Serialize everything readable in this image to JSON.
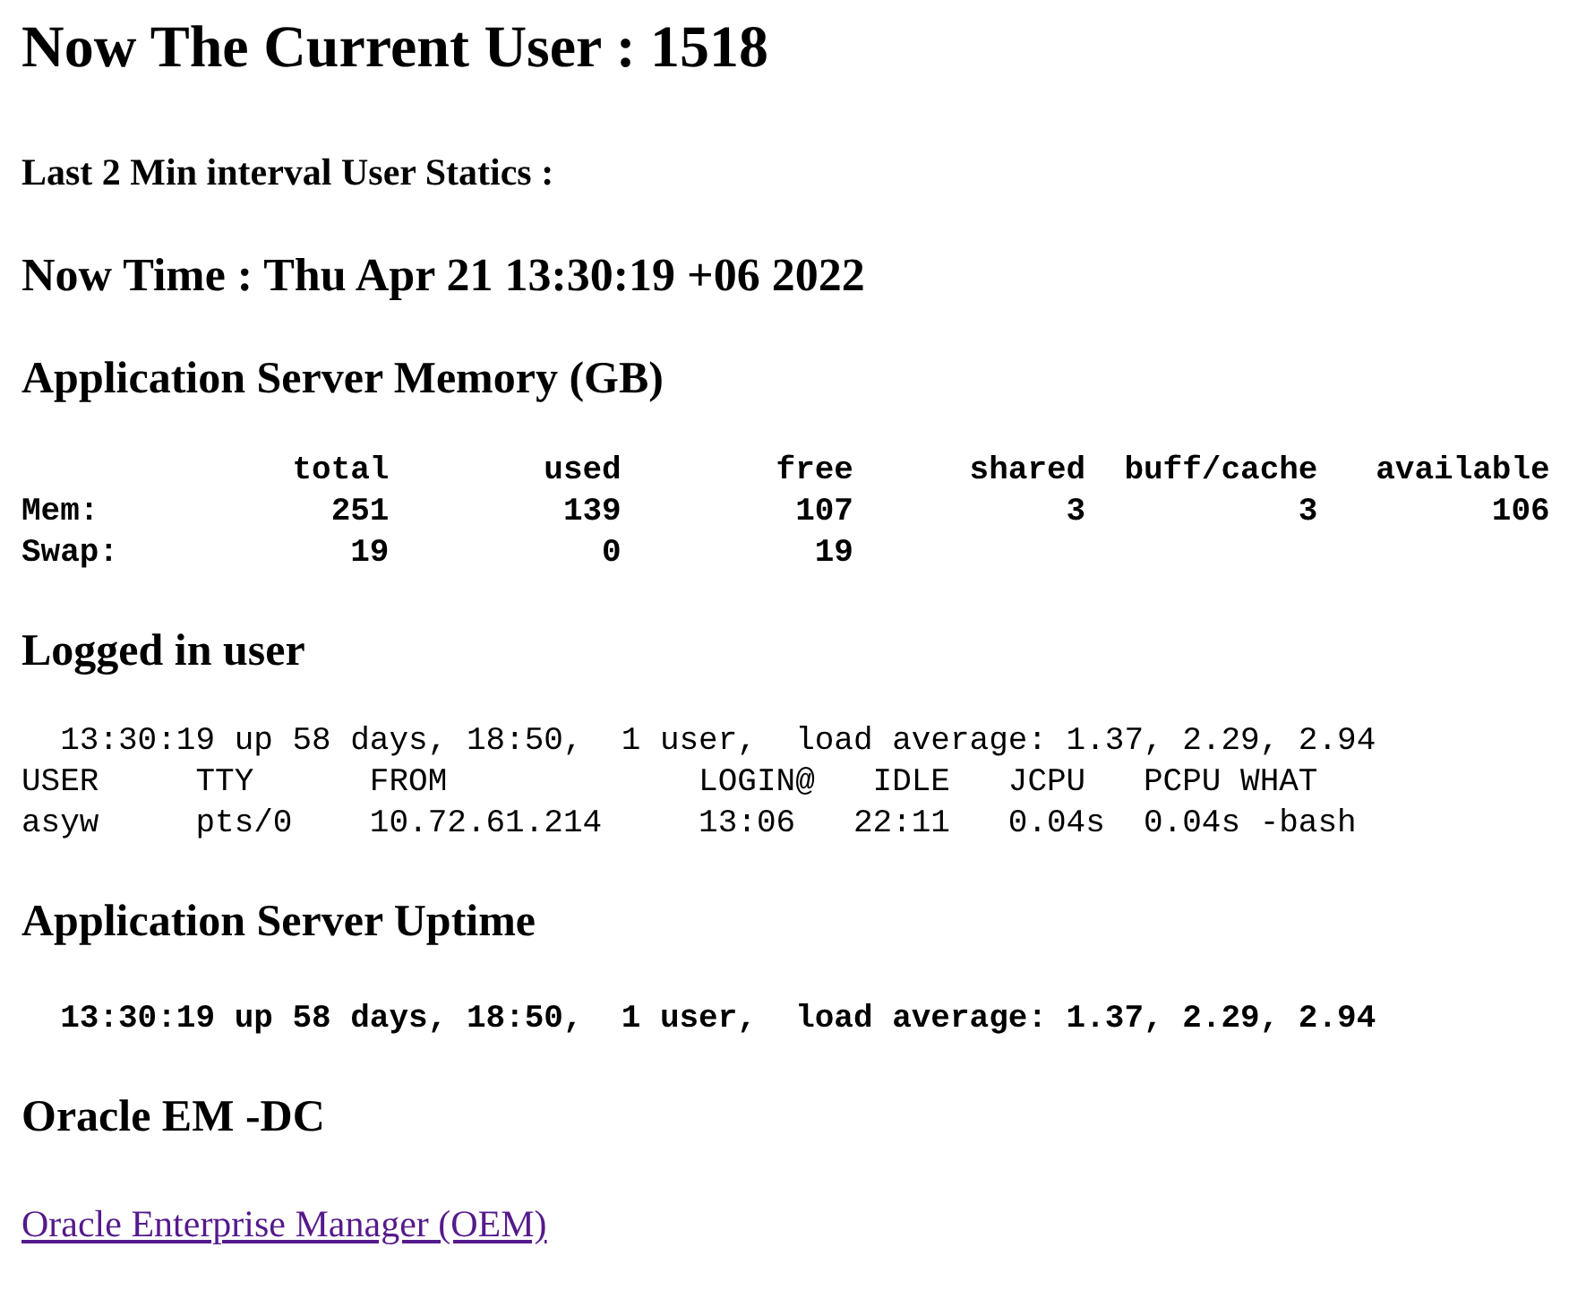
{
  "title": "Now The Current User : 1518",
  "subtitle": "Last 2 Min interval User Statics :",
  "now_time": "Now Time : Thu Apr 21 13:30:19 +06 2022",
  "sections": [
    {
      "heading": "Application Server Memory (GB)",
      "kind": "console",
      "bold": true,
      "lines": [
        "              total        used        free      shared  buff/cache   available",
        "Mem:            251         139         107           3           3         106",
        "Swap:            19           0          19"
      ]
    },
    {
      "heading": "Logged in user",
      "kind": "console",
      "bold": false,
      "lines": [
        "  13:30:19 up 58 days, 18:50,  1 user,  load average: 1.37, 2.29, 2.94",
        "USER     TTY      FROM             LOGIN@   IDLE   JCPU   PCPU WHAT",
        "asyw     pts/0    10.72.61.214     13:06   22:11   0.04s  0.04s -bash"
      ]
    },
    {
      "heading": "Application Server Uptime",
      "kind": "console",
      "bold": true,
      "lines": [
        "  13:30:19 up 58 days, 18:50,  1 user,  load average: 1.37, 2.29, 2.94"
      ]
    },
    {
      "heading": "Oracle EM -DC",
      "kind": "link",
      "link": "Oracle Enterprise Manager (OEM)"
    }
  ]
}
